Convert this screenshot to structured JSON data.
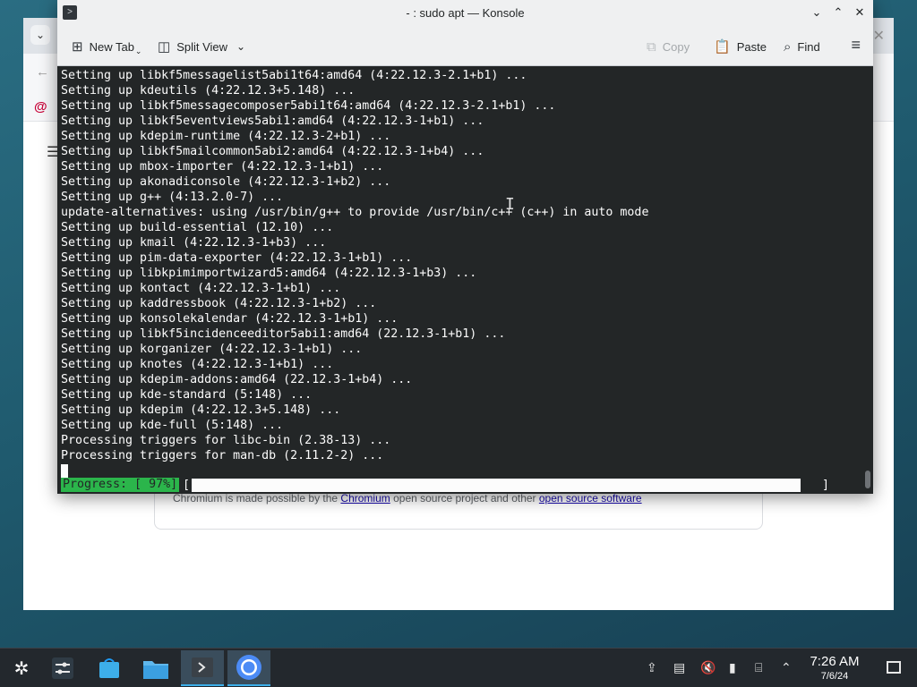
{
  "konsole": {
    "title": "- : sudo apt — Konsole",
    "toolbar": {
      "new_tab": "New Tab",
      "split_view": "Split View",
      "copy": "Copy",
      "paste": "Paste",
      "find": "Find"
    },
    "terminal_lines": [
      "Setting up libkf5messagelist5abi1t64:amd64 (4:22.12.3-2.1+b1) ...",
      "Setting up kdeutils (4:22.12.3+5.148) ...",
      "Setting up libkf5messagecomposer5abi1t64:amd64 (4:22.12.3-2.1+b1) ...",
      "Setting up libkf5eventviews5abi1:amd64 (4:22.12.3-1+b1) ...",
      "Setting up kdepim-runtime (4:22.12.3-2+b1) ...",
      "Setting up libkf5mailcommon5abi2:amd64 (4:22.12.3-1+b4) ...",
      "Setting up mbox-importer (4:22.12.3-1+b1) ...",
      "Setting up akonadiconsole (4:22.12.3-1+b2) ...",
      "Setting up g++ (4:13.2.0-7) ...",
      "update-alternatives: using /usr/bin/g++ to provide /usr/bin/c++ (c++) in auto mode",
      "Setting up build-essential (12.10) ...",
      "Setting up kmail (4:22.12.3-1+b3) ...",
      "Setting up pim-data-exporter (4:22.12.3-1+b1) ...",
      "Setting up libkpimimportwizard5:amd64 (4:22.12.3-1+b3) ...",
      "Setting up kontact (4:22.12.3-1+b1) ...",
      "Setting up kaddressbook (4:22.12.3-1+b2) ...",
      "Setting up konsolekalendar (4:22.12.3-1+b1) ...",
      "Setting up libkf5incidenceeditor5abi1:amd64 (22.12.3-1+b1) ...",
      "Setting up korganizer (4:22.12.3-1+b1) ...",
      "Setting up knotes (4:22.12.3-1+b1) ...",
      "Setting up kdepim-addons:amd64 (22.12.3-1+b4) ...",
      "Setting up kde-standard (5:148) ...",
      "Setting up kdepim (4:22.12.3+5.148) ...",
      "Setting up kde-full (5:148) ...",
      "Processing triggers for libc-bin (2.38-13) ...",
      "Processing triggers for man-db (2.11.2-2) ..."
    ],
    "progress": {
      "label": "Progress: [ 97%]",
      "open_bracket": "[",
      "close_bracket": "]",
      "percent": 97
    }
  },
  "chromium": {
    "credit_prefix": "Chromium is made possible by the ",
    "credit_link1": "Chromium",
    "credit_middle": " open source project and other ",
    "credit_link2": "open source software"
  },
  "taskbar": {
    "time": "7:26 AM",
    "date": "7/6/24"
  },
  "colors": {
    "terminal_bg": "#232627",
    "progress_label_bg": "#2bb54b",
    "taskbar_bg": "#23282d",
    "accent": "#3daee9"
  }
}
